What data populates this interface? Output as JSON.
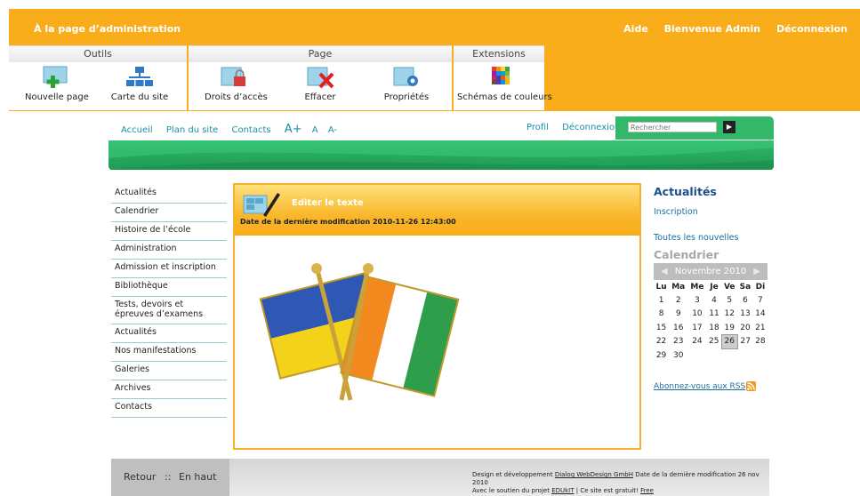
{
  "admin": {
    "home_link": "À la page d’administration",
    "help": "Aide",
    "welcome": "Bienvenue Admin",
    "logout": "Déconnexion"
  },
  "toolbar": {
    "groups": [
      {
        "title": "Outils",
        "tools": [
          {
            "label": "Nouvelle page",
            "icon": "new-page-icon"
          },
          {
            "label": "Carte du site",
            "icon": "sitemap-icon"
          }
        ]
      },
      {
        "title": "Page",
        "tools": [
          {
            "label": "Droits d’accès",
            "icon": "access-rights-icon"
          },
          {
            "label": "Effacer",
            "icon": "delete-icon"
          },
          {
            "label": "Propriétés",
            "icon": "properties-icon"
          }
        ]
      },
      {
        "title": "Extensions",
        "tools": [
          {
            "label": "Schémas de couleurs",
            "icon": "color-scheme-icon"
          }
        ]
      }
    ]
  },
  "topnav": {
    "home": "Accueil",
    "sitemap": "Plan du site",
    "contacts": "Contacts",
    "font_larger": "A+",
    "font_normal": "A",
    "font_smaller": "A-",
    "profile": "Profil",
    "logout": "Déconnexion",
    "search_placeholder": "Rechercher"
  },
  "sidebar": {
    "items": [
      {
        "label": "Actualités"
      },
      {
        "label": "Calendrier"
      },
      {
        "label": "Histoire de l’école"
      },
      {
        "label": "Administration"
      },
      {
        "label": "Admission et inscription"
      },
      {
        "label": "Bibliothèque"
      },
      {
        "label": "Tests, devoirs et épreuves d’examens"
      },
      {
        "label": "Actualités"
      },
      {
        "label": "Nos manifestations"
      },
      {
        "label": "Galeries"
      },
      {
        "label": "Archives"
      },
      {
        "label": "Contacts"
      }
    ]
  },
  "content": {
    "edit_label": "Editer le texte",
    "modified": "Date de la dernière modification 2010-11-26 12:43:00",
    "image_icon": "crossed-flags-image"
  },
  "right": {
    "news_title": "Actualités",
    "inscription": "Inscription",
    "all_news": "Toutes les nouvelles",
    "calendar_title": "Calendrier",
    "rss": "Abonnez-vous aux RSS"
  },
  "calendar": {
    "month": "Novembre 2010",
    "weekdays": [
      "Lu",
      "Ma",
      "Me",
      "Je",
      "Ve",
      "Sa",
      "Di"
    ],
    "weeks": [
      [
        "1",
        "2",
        "3",
        "4",
        "5",
        "6",
        "7"
      ],
      [
        "8",
        "9",
        "10",
        "11",
        "12",
        "13",
        "14"
      ],
      [
        "15",
        "16",
        "17",
        "18",
        "19",
        "20",
        "21"
      ],
      [
        "22",
        "23",
        "24",
        "25",
        "26",
        "27",
        "28"
      ],
      [
        "29",
        "30",
        "",
        "",
        "",
        "",
        ""
      ]
    ],
    "today": "26"
  },
  "footer": {
    "back": "Retour",
    "separator": "::",
    "top": "En haut",
    "design_prefix": "Design et développement",
    "design_company": "Dialog WebDesign GmbH",
    "design_suffix": "Date de la dernière modification 26 nov 2010",
    "support_prefix": "Avec le soutien du projet",
    "support_project": "EDUkIT",
    "support_mid": "| Ce site est gratuit!",
    "support_free": "Free"
  },
  "colors": {
    "admin_orange": "#f9ad1a",
    "site_green": "#2fb86b",
    "link_blue": "#1a8fa5",
    "heading_blue": "#1b4e8c"
  }
}
